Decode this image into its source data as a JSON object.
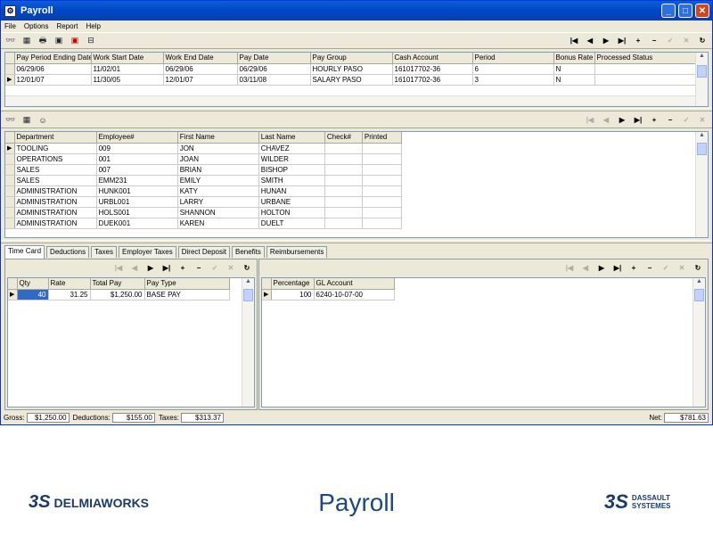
{
  "window": {
    "title": "Payroll"
  },
  "menu": [
    "File",
    "Options",
    "Report",
    "Help"
  ],
  "pay_grid": {
    "columns": [
      "Pay Period Ending Date",
      "Work Start Date",
      "Work End Date",
      "Pay Date",
      "Pay Group",
      "Cash Account",
      "Period",
      "Bonus Rate",
      "Processed Status"
    ],
    "rows": [
      [
        "06/29/06",
        "11/02/01",
        "06/29/06",
        "06/29/06",
        "HOURLY PASO",
        "161017702-36",
        "6",
        "N",
        ""
      ],
      [
        "12/01/07",
        "11/30/05",
        "12/01/07",
        "03/11/08",
        "SALARY PASO",
        "161017702-36",
        "3",
        "N",
        ""
      ]
    ]
  },
  "emp_grid": {
    "columns": [
      "Department",
      "Employee#",
      "First Name",
      "Last Name",
      "Check#",
      "Printed"
    ],
    "rows": [
      [
        "TOOLING",
        "009",
        "JON",
        "CHAVEZ",
        "",
        ""
      ],
      [
        "OPERATIONS",
        "001",
        "JOAN",
        "WILDER",
        "",
        ""
      ],
      [
        "SALES",
        "007",
        "BRIAN",
        "BISHOP",
        "",
        ""
      ],
      [
        "SALES",
        "EMM231",
        "EMILY",
        "SMITH",
        "",
        ""
      ],
      [
        "ADMINISTRATION",
        "HUNK001",
        "KATY",
        "HUNAN",
        "",
        ""
      ],
      [
        "ADMINISTRATION",
        "URBL001",
        "LARRY",
        "URBANE",
        "",
        ""
      ],
      [
        "ADMINISTRATION",
        "HOLS001",
        "SHANNON",
        "HOLTON",
        "",
        ""
      ],
      [
        "ADMINISTRATION",
        "DUEK001",
        "KAREN",
        "DUELT",
        "",
        ""
      ]
    ]
  },
  "tabs": [
    "Time Card",
    "Deductions",
    "Taxes",
    "Employer Taxes",
    "Direct Deposit",
    "Benefits",
    "Reimbursements"
  ],
  "time_grid": {
    "columns": [
      "Qty",
      "Rate",
      "Total Pay",
      "Pay Type"
    ],
    "rows": [
      [
        "40",
        "31.25",
        "$1,250.00",
        "BASE PAY"
      ]
    ]
  },
  "gl_grid": {
    "columns": [
      "Percentage",
      "GL Account"
    ],
    "rows": [
      [
        "100",
        "6240-10-07-00"
      ]
    ]
  },
  "status": {
    "gross_label": "Gross:",
    "gross": "$1,250.00",
    "deductions_label": "Deductions:",
    "deductions": "$155.00",
    "taxes_label": "Taxes:",
    "taxes": "$313.37",
    "net_label": "Net:",
    "net": "$781.63"
  },
  "footer": {
    "left_logo": "DELMIAWORKS",
    "title": "Payroll",
    "right_logo_line1": "DASSAULT",
    "right_logo_line2": "SYSTEMES"
  },
  "colors": {
    "title_bar": "#0a5fd8",
    "selection": "#316ac5",
    "footer_text": "#1b4a7a"
  }
}
